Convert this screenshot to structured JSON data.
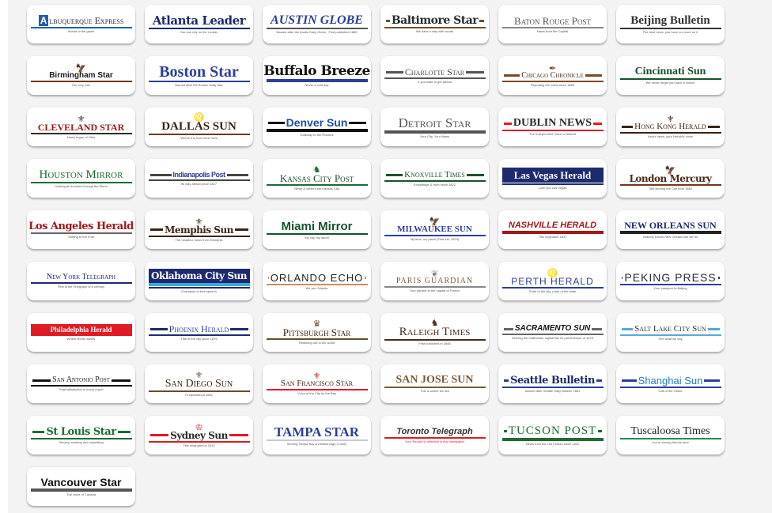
{
  "newspapers": [
    {
      "name": "Albuquerque Express",
      "tagline": "Ahead of the game",
      "style": "smallcaps",
      "color": "#2b2b2b",
      "accent": "#1f5fae",
      "emblem": "A-box",
      "font": "serif",
      "size": 12
    },
    {
      "name": "Atlanta Leader",
      "tagline": "You can rely on the Leader",
      "style": "blackletter",
      "color": "#1e2a6e",
      "accent": "#1e2a6e",
      "emblem": "",
      "font": "serif",
      "size": 15
    },
    {
      "name": "Austin Globe",
      "tagline": "Named after the Austin Daily Globe · First published 1889",
      "style": "italic-caps",
      "color": "#2c3e9a",
      "accent": "#555555",
      "emblem": "",
      "font": "serif",
      "size": 16
    },
    {
      "name": "Baltimore Star",
      "tagline": "We have a way with words",
      "style": "blackletter",
      "color": "#2b2b2b",
      "accent": "#7a4a2a",
      "emblem": "",
      "font": "serif",
      "size": 14
    },
    {
      "name": "Baton Rouge Post",
      "tagline": "News from the Capital",
      "style": "smallcaps",
      "color": "#555555",
      "accent": "#888888",
      "emblem": "",
      "font": "serif",
      "size": 13
    },
    {
      "name": "Beijing Bulletin",
      "tagline": "The best news, you have our word on it",
      "style": "serif",
      "color": "#333333",
      "accent": "#333333",
      "emblem": "",
      "font": "serif",
      "size": 15
    },
    {
      "name": "Birmingham Star",
      "tagline": "Our very own",
      "style": "bold-sans",
      "color": "#1a1a1a",
      "accent": "#6b3a1f",
      "emblem": "eagle",
      "font": "sans",
      "size": 10
    },
    {
      "name": "Boston Star",
      "tagline": "Named after the Boston Daily Star",
      "style": "serif",
      "color": "#2c3e9a",
      "accent": "#2c3e9a",
      "emblem": "",
      "font": "serif",
      "size": 20
    },
    {
      "name": "Buffalo Breeze",
      "tagline": "Never a cold day",
      "style": "blackletter",
      "color": "#111111",
      "accent": "#2c3e9a",
      "emblem": "",
      "font": "serif",
      "size": 17
    },
    {
      "name": "Charlotte Star",
      "tagline": "If you want to get ahead",
      "style": "smallcaps",
      "color": "#444444",
      "accent": "#555555",
      "emblem": "",
      "font": "serif",
      "size": 12
    },
    {
      "name": "Chicago Chronicle",
      "tagline": "Reporting the news since 1880",
      "style": "smallcaps",
      "color": "#4a2c1a",
      "accent": "#7a4a2a",
      "emblem": "quill",
      "font": "serif",
      "size": 10
    },
    {
      "name": "Cincinnati Sun",
      "tagline": "We never forget you have a choice",
      "style": "bold-serif",
      "color": "#14532d",
      "accent": "#14532d",
      "emblem": "",
      "font": "serif",
      "size": 14
    },
    {
      "name": "Cleveland Star",
      "tagline": "News organ of Ohio",
      "style": "caps",
      "color": "#a01818",
      "accent": "#2b2b2b",
      "emblem": "crest",
      "font": "serif",
      "size": 12
    },
    {
      "name": "Dallas Sun",
      "tagline": "Where the Sun never sets",
      "style": "caps",
      "color": "#3b2414",
      "accent": "#6b3a1f",
      "emblem": "lion",
      "font": "serif",
      "size": 15
    },
    {
      "name": "Denver Sun",
      "tagline": "Gateway to the Rockies",
      "style": "bold-sans",
      "color": "#1f4aa8",
      "accent": "#111111",
      "emblem": "",
      "font": "sans",
      "size": 14
    },
    {
      "name": "Detroit Star",
      "tagline": "Your City, Your News",
      "style": "smallcaps",
      "color": "#555555",
      "accent": "#555555",
      "emblem": "",
      "font": "serif",
      "size": 17
    },
    {
      "name": "Dublin News",
      "tagline": "The Independent Voice of Ireland",
      "style": "caps",
      "color": "#2b2b2b",
      "accent": "#e01b24",
      "emblem": "",
      "font": "serif",
      "size": 14
    },
    {
      "name": "Hong Kong Herald",
      "tagline": "Asia's news, your Herald's voice",
      "style": "smallcaps",
      "color": "#3b2414",
      "accent": "#3b2414",
      "emblem": "crest",
      "font": "serif",
      "size": 11
    },
    {
      "name": "Houston Mirror",
      "tagline": "Looking at Houston through the Mirror",
      "style": "smallcaps",
      "color": "#1f6b33",
      "accent": "#1f6b33",
      "emblem": "",
      "font": "serif",
      "size": 15
    },
    {
      "name": "Indianapolis Post",
      "tagline": "Its way ahead since 1827",
      "style": "condensed",
      "color": "#2c3e9a",
      "accent": "#444444",
      "emblem": "",
      "font": "sans",
      "size": 9
    },
    {
      "name": "Kansas City Post",
      "tagline": "News & views from Kansas City",
      "style": "smallcaps",
      "color": "#1f5030",
      "accent": "#1f6b33",
      "emblem": "horse",
      "font": "serif",
      "size": 13
    },
    {
      "name": "Knoxville Times",
      "tagline": "Knowledge & truth since 1822",
      "style": "smallcaps",
      "color": "#1f5030",
      "accent": "#1f5030",
      "emblem": "",
      "font": "serif",
      "size": 11
    },
    {
      "name": "Las Vegas Herald",
      "tagline": "Love you Las Vegas",
      "style": "serif-inverse",
      "color": "#ffffff",
      "accent": "#1e2a6e",
      "emblem": "",
      "font": "serif",
      "size": 13
    },
    {
      "name": "London Mercury",
      "tagline": "Title serving the City from 1682",
      "style": "blackletter",
      "color": "#4a2c1a",
      "accent": "#6b3a1f",
      "emblem": "eagle",
      "font": "serif",
      "size": 12
    },
    {
      "name": "Los Angeles Herald",
      "tagline": "Getting to the truth",
      "style": "blackletter",
      "color": "#a01818",
      "accent": "#666666",
      "emblem": "",
      "font": "serif",
      "size": 13
    },
    {
      "name": "Memphis Sun",
      "tagline": "The headline news from Memphis",
      "style": "blackletter",
      "color": "#3b2414",
      "accent": "#3b2414",
      "emblem": "crest",
      "font": "serif",
      "size": 12
    },
    {
      "name": "Miami Mirror",
      "tagline": "My city, my world",
      "style": "bold-sans",
      "color": "#14532d",
      "accent": "#14532d",
      "emblem": "",
      "font": "sans",
      "size": 15
    },
    {
      "name": "Milwaukee Sun",
      "tagline": "My time, my place (First est. 1924)",
      "style": "caps",
      "color": "#2c3e9a",
      "accent": "#2c3e9a",
      "emblem": "eagle",
      "font": "serif",
      "size": 11
    },
    {
      "name": "Nashville Herald",
      "tagline": "Title originated 1837",
      "style": "bold-italic-caps",
      "color": "#a01818",
      "accent": "#a01818",
      "emblem": "",
      "font": "sans",
      "size": 11
    },
    {
      "name": "New Orleans Sun",
      "tagline": "Nobody knows New Orleans like we do",
      "style": "caps",
      "color": "#1e2a6e",
      "accent": "#222222",
      "emblem": "",
      "font": "serif",
      "size": 12
    },
    {
      "name": "New York Telegraph",
      "tagline": "First in the Telegraph of a century",
      "style": "smallcaps",
      "color": "#1e2a6e",
      "accent": "#1e2a6e",
      "emblem": "",
      "font": "serif",
      "size": 10
    },
    {
      "name": "Oklahoma City Sun",
      "tagline": "Champion of free speech",
      "style": "blackletter-inverse",
      "color": "#ffffff",
      "accent": "#1e2a6e",
      "emblem": "",
      "font": "serif",
      "size": 12
    },
    {
      "name": "Orlando Echo",
      "tagline": "We are Orlando",
      "style": "thin-caps",
      "color": "#222222",
      "accent": "#c8905a",
      "emblem": "",
      "font": "sans",
      "size": 13
    },
    {
      "name": "Paris Guardian",
      "tagline": "Your partner in the capital of France",
      "style": "spaced-caps",
      "color": "#7a5a3a",
      "accent": "#888888",
      "emblem": "flourish",
      "font": "serif",
      "size": 10
    },
    {
      "name": "Perth Herald",
      "tagline": "Pride of the city, pride of the state",
      "style": "spaced-caps",
      "color": "#2c3e9a",
      "accent": "#2c3e9a",
      "emblem": "lion",
      "font": "sans",
      "size": 12
    },
    {
      "name": "Peking Press",
      "tagline": "Your passport to Beijing",
      "style": "thin-caps",
      "color": "#2b2b2b",
      "accent": "#2c3e9a",
      "emblem": "",
      "font": "sans",
      "size": 14
    },
    {
      "name": "Philadelphia Herald",
      "tagline": "Where liberty dwells",
      "style": "inverse-red",
      "color": "#ffffff",
      "accent": "#e01b24",
      "emblem": "",
      "font": "serif",
      "size": 9
    },
    {
      "name": "Phoenix Herald",
      "tagline": "Title of the city since 1879",
      "style": "smallcaps",
      "color": "#2c3e9a",
      "accent": "#1e2a6e",
      "emblem": "",
      "font": "serif",
      "size": 12
    },
    {
      "name": "Pittsburgh Star",
      "tagline": "Reaching out to the world",
      "style": "smallcaps",
      "color": "#3b2414",
      "accent": "#6b4a2a",
      "emblem": "crown",
      "font": "serif",
      "size": 13
    },
    {
      "name": "Raleigh Times",
      "tagline": "First published in 1848",
      "style": "smallcaps",
      "color": "#4a2c1a",
      "accent": "#4a2c1a",
      "emblem": "knight",
      "font": "serif",
      "size": 15
    },
    {
      "name": "Sacramento Sun",
      "tagline": "Serving the Californian capital like its predecessor of 1878",
      "style": "bold-italic-caps",
      "color": "#111111",
      "accent": "#666666",
      "emblem": "",
      "font": "sans",
      "size": 10
    },
    {
      "name": "Salt Lake City Sun",
      "tagline": "See what we say",
      "style": "smallcaps",
      "color": "#333333",
      "accent": "#5aa8d8",
      "emblem": "",
      "font": "serif",
      "size": 11
    },
    {
      "name": "San Antonio Post",
      "tagline": "Total satisfaction in every report",
      "style": "smallcaps",
      "color": "#222222",
      "accent": "#111111",
      "emblem": "",
      "font": "serif",
      "size": 10
    },
    {
      "name": "San Diego Sun",
      "tagline": "Firstpublished 1881",
      "style": "smallcaps",
      "color": "#3b2414",
      "accent": "#6b4a2a",
      "emblem": "fleur",
      "font": "serif",
      "size": 14
    },
    {
      "name": "San Francisco Star",
      "tagline": "Voice of the City by the Bay",
      "style": "smallcaps",
      "color": "#3b2414",
      "accent": "#e01b24",
      "emblem": "crest",
      "font": "serif",
      "size": 11
    },
    {
      "name": "San Jose Sun",
      "tagline": "This is where we live",
      "style": "caps",
      "color": "#7a5a3a",
      "accent": "#7a5a3a",
      "emblem": "",
      "font": "serif",
      "size": 14
    },
    {
      "name": "Seattle Bulletin",
      "tagline": "Named after Seattle Daily Bulletin 1861",
      "style": "blackletter",
      "color": "#1e2a6e",
      "accent": "#2c3e9a",
      "emblem": "",
      "font": "serif",
      "size": 13
    },
    {
      "name": "Shanghai Sun",
      "tagline": "Call of the Orient",
      "style": "sans",
      "color": "#1f7ac8",
      "accent": "#2c3e9a",
      "emblem": "",
      "font": "sans",
      "size": 13
    },
    {
      "name": "St Louis Star",
      "tagline": "Striving, seeking and unyielding",
      "style": "blackletter",
      "color": "#1f6b33",
      "accent": "#1f6b33",
      "emblem": "",
      "font": "serif",
      "size": 13
    },
    {
      "name": "Sydney Sun",
      "tagline": "Title originated in 1810",
      "style": "blackletter",
      "color": "#2b2b2b",
      "accent": "#e01b24",
      "emblem": "crest-red",
      "font": "serif",
      "size": 12
    },
    {
      "name": "Tampa Star",
      "tagline": "Serving Tampa Bay & Hillsborough County",
      "style": "caps",
      "color": "#2c3e9a",
      "accent": "#c8c8d8",
      "emblem": "",
      "font": "serif",
      "size": 17
    },
    {
      "name": "Toronto Telegraph",
      "tagline": "Your Toronto is reflected in this newspaper",
      "style": "bold-italic",
      "color": "#333333",
      "accent": "#e01b24",
      "emblem": "",
      "font": "sans",
      "size": 11
    },
    {
      "name": "Tucson Post",
      "tagline": "News from the Old Pueblo since 1901",
      "style": "thin-caps",
      "color": "#1f6b33",
      "accent": "#1f6b33",
      "emblem": "",
      "font": "serif",
      "size": 15
    },
    {
      "name": "Tuscaloosa Times",
      "tagline": "You're among friends here",
      "style": "serif",
      "color": "#222222",
      "accent": "#2a8a55",
      "emblem": "",
      "font": "serif",
      "size": 14
    },
    {
      "name": "Vancouver Star",
      "tagline": "The voice of Canada",
      "style": "bold-sans",
      "color": "#111111",
      "accent": "#555555",
      "emblem": "",
      "font": "sans",
      "size": 14
    }
  ]
}
